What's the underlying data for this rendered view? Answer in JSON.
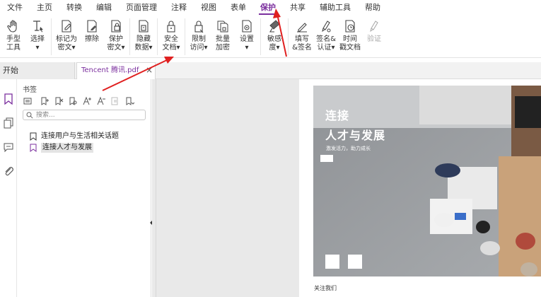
{
  "menu": [
    "文件",
    "主页",
    "转换",
    "编辑",
    "页面管理",
    "注释",
    "视图",
    "表单",
    "保护",
    "共享",
    "辅助工具",
    "帮助"
  ],
  "menu_active": "保护",
  "ribbon": [
    {
      "label": "手型\n工具",
      "icon": "hand-icon"
    },
    {
      "label": "选择\n▾",
      "icon": "text-select-icon"
    },
    {
      "label": "标记为\n密文▾",
      "icon": "redact-mark-icon"
    },
    {
      "label": "擦除",
      "icon": "eraser-icon"
    },
    {
      "label": "保护\n密文▾",
      "icon": "protect-redaction-icon"
    },
    {
      "label": "隐藏\n数据▾",
      "icon": "hide-data-icon"
    },
    {
      "label": "安全\n文档▾",
      "icon": "lock-document-icon"
    },
    {
      "label": "限制\n访问▾",
      "icon": "restrict-access-icon"
    },
    {
      "label": "批量\n加密",
      "icon": "batch-encrypt-icon"
    },
    {
      "label": "设置\n▾",
      "icon": "settings-icon"
    },
    {
      "label": "敏感\n度▾",
      "icon": "sensitivity-icon"
    },
    {
      "label": "填写\n&签名",
      "icon": "fill-sign-icon"
    },
    {
      "label": "签名&\n认证▾",
      "icon": "sign-certify-icon"
    },
    {
      "label": "时间\n戳文档",
      "icon": "timestamp-icon"
    },
    {
      "label": "验证",
      "icon": "verify-icon"
    }
  ],
  "tabs": {
    "start": "开始",
    "doc": "Tencent 腾讯.pdf",
    "close": "×"
  },
  "panel": {
    "title": "书签",
    "search_placeholder": "搜索...",
    "bookmarks": [
      "连接用户与生活相关话题",
      "连接人才与发展"
    ]
  },
  "document": {
    "title_line1": "连接",
    "title_line2": "人才与发展",
    "subtitle": "激发活力，助力成长",
    "footer": "关注我们"
  },
  "colors": {
    "accent": "#7b2f9e",
    "arrow": "#e02020"
  }
}
